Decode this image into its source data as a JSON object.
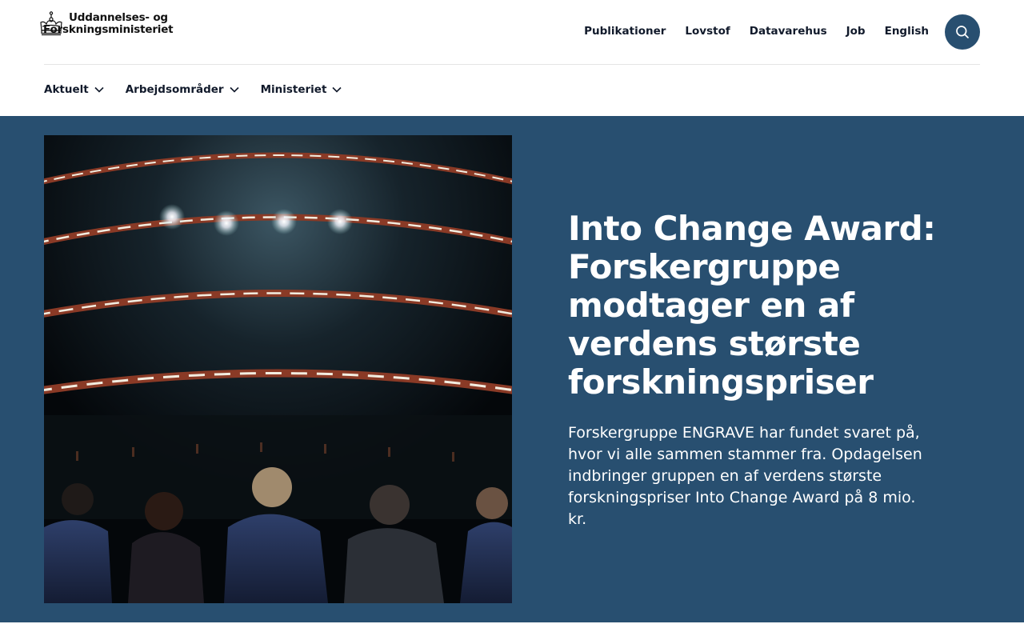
{
  "header": {
    "logo": {
      "line1": "Uddannelses- og",
      "line2": "Forskningsministeriet",
      "icon": "crown-icon"
    },
    "top_nav": [
      "Publikationer",
      "Lovstof",
      "Datavarehus",
      "Job",
      "English"
    ],
    "search": {
      "icon": "search-icon"
    }
  },
  "main_nav": [
    {
      "label": "Aktuelt",
      "icon": "chevron-down-icon"
    },
    {
      "label": "Arbejdsområder",
      "icon": "chevron-down-icon"
    },
    {
      "label": "Ministeriet",
      "icon": "chevron-down-icon"
    }
  ],
  "hero": {
    "title": "Into Change Award: Forskergruppe modtager en af verdens største forskningspriser",
    "lead": "Forskergruppe ENGRAVE har fundet svaret på, hvor vi alle sammen stammer fra. Opdagelsen indbringer gruppen en af verdens største forskningspriser Into Change Award på 8 mio. kr."
  },
  "colors": {
    "accent": "#284f70",
    "text": "#111a2b",
    "background": "#ffffff"
  }
}
